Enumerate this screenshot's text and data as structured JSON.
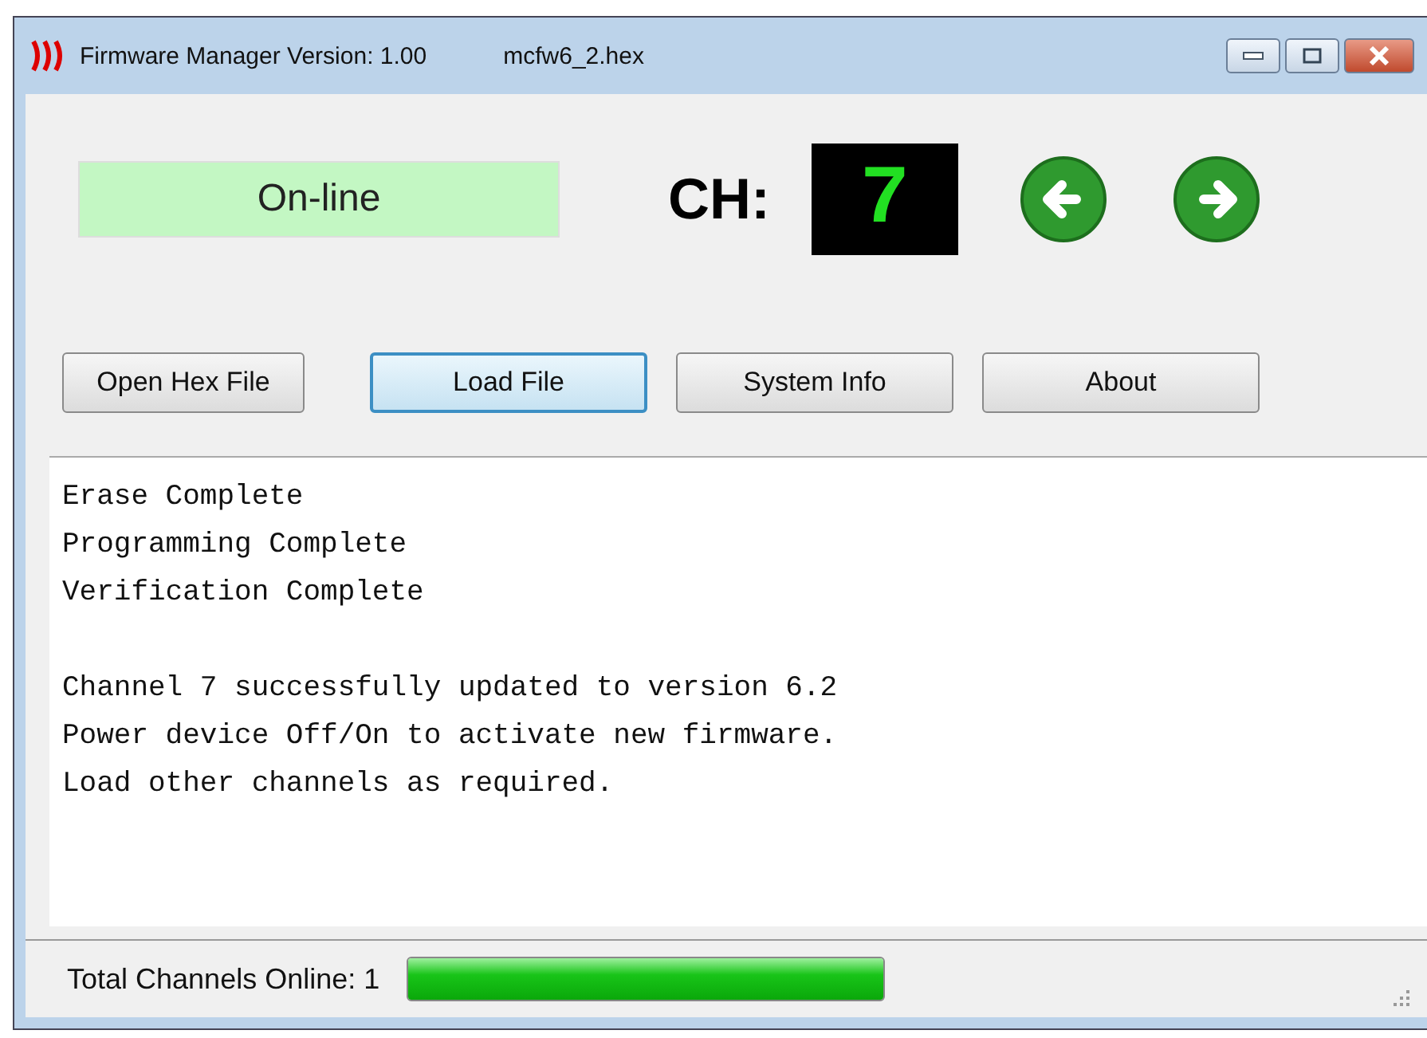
{
  "window": {
    "title": "Firmware Manager Version: 1.00",
    "file": "mcfw6_2.hex"
  },
  "status_box": {
    "label": "On-line"
  },
  "channel": {
    "label": "CH:",
    "value": "7"
  },
  "buttons": [
    {
      "label": "Open Hex File",
      "focused": false
    },
    {
      "label": "Load File",
      "focused": true
    },
    {
      "label": "System Info",
      "focused": false
    },
    {
      "label": "About",
      "focused": false
    }
  ],
  "log": [
    [
      "Erase Complete",
      "Programming Complete",
      "Verification Complete"
    ],
    [
      "Channel 7 successfully updated to version 6.2",
      "Power device Off/On to activate new firmware.",
      "Load other channels as required."
    ]
  ],
  "status_bar": {
    "label": "Total Channels Online: 1",
    "progress": {
      "level": 1
    }
  }
}
